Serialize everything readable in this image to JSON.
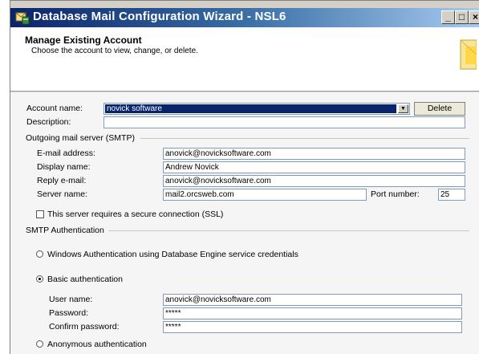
{
  "window": {
    "title": "Database Mail Configuration Wizard - NSL6",
    "minimize": "_",
    "maximize": "□",
    "close": "×"
  },
  "header": {
    "title": "Manage Existing Account",
    "subtitle": "Choose the account to view, change, or delete."
  },
  "account": {
    "name_label": "Account name:",
    "name_value": "novick software",
    "delete_label": "Delete",
    "description_label": "Description:",
    "description_value": ""
  },
  "smtp": {
    "group_label": "Outgoing mail server (SMTP)",
    "email_label": "E-mail address:",
    "email_value": "anovick@novicksoftware.com",
    "display_label": "Display name:",
    "display_value": "Andrew Novick",
    "reply_label": "Reply e-mail:",
    "reply_value": "anovick@novicksoftware.com",
    "server_label": "Server name:",
    "server_value": "mail2.orcsweb.com",
    "port_label": "Port number:",
    "port_value": "25",
    "ssl_label": "This server requires a secure connection (SSL)"
  },
  "auth": {
    "group_label": "SMTP Authentication",
    "windows_label": "Windows Authentication using Database Engine service credentials",
    "basic_label": "Basic authentication",
    "user_label": "User name:",
    "user_value": "anovick@novicksoftware.com",
    "password_label": "Password:",
    "password_value": "*****",
    "confirm_label": "Confirm password:",
    "confirm_value": "*****",
    "anonymous_label": "Anonymous authentication",
    "selected": "basic"
  }
}
